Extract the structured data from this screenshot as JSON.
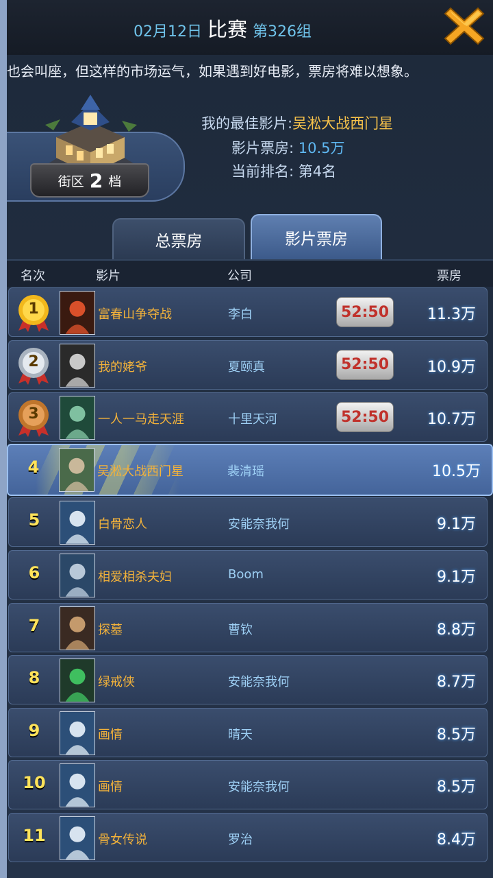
{
  "header": {
    "date": "02月12日",
    "match": "比赛",
    "group": "第326组"
  },
  "ticker": "也会叫座，但这样的市场运气，如果遇到好电影，票房将难以想象。",
  "district": {
    "label_left": "街区",
    "level": "2",
    "label_right": "档"
  },
  "best": {
    "film_label": "我的最佳影片:",
    "film_name": "吴淞大战西门星",
    "box_label": "影片票房:",
    "box_value": "10.5万",
    "rank_label": "当前排名:",
    "rank_value": "第4名"
  },
  "tabs": {
    "total": "总票房",
    "film": "影片票房",
    "active": "film"
  },
  "columns": {
    "rank": "名次",
    "film": "影片",
    "company": "公司",
    "box": "票房"
  },
  "rows": [
    {
      "rank": "1",
      "film": "富春山争夺战",
      "company": "李白",
      "timer": "52:50",
      "box": "11.3万",
      "medal": "gold"
    },
    {
      "rank": "2",
      "film": "我的姥爷",
      "company": "夏颐真",
      "timer": "52:50",
      "box": "10.9万",
      "medal": "silver"
    },
    {
      "rank": "3",
      "film": "一人一马走天涯",
      "company": "十里天河",
      "timer": "52:50",
      "box": "10.7万",
      "medal": "bronze"
    },
    {
      "rank": "4",
      "film": "吴淞大战西门星",
      "company": "裴清瑶",
      "box": "10.5万",
      "highlight": true
    },
    {
      "rank": "5",
      "film": "白骨恋人",
      "company": "安能奈我何",
      "box": "9.1万"
    },
    {
      "rank": "6",
      "film": "相爱相杀夫妇",
      "company": "Boom",
      "box": "9.1万"
    },
    {
      "rank": "7",
      "film": "探墓",
      "company": "曹钦",
      "box": "8.8万"
    },
    {
      "rank": "8",
      "film": "绿戒侠",
      "company": "安能奈我何",
      "box": "8.7万"
    },
    {
      "rank": "9",
      "film": "画情",
      "company": "晴天",
      "box": "8.5万"
    },
    {
      "rank": "10",
      "film": "画情",
      "company": "安能奈我何",
      "box": "8.5万"
    },
    {
      "rank": "11",
      "film": "骨女传说",
      "company": "罗治",
      "box": "8.4万"
    }
  ],
  "colors": {
    "gold_text": "#f3b23a",
    "company_text": "#9ed0f5",
    "timer_text": "#c0322c",
    "rank_yellow": "#ffe35a"
  }
}
